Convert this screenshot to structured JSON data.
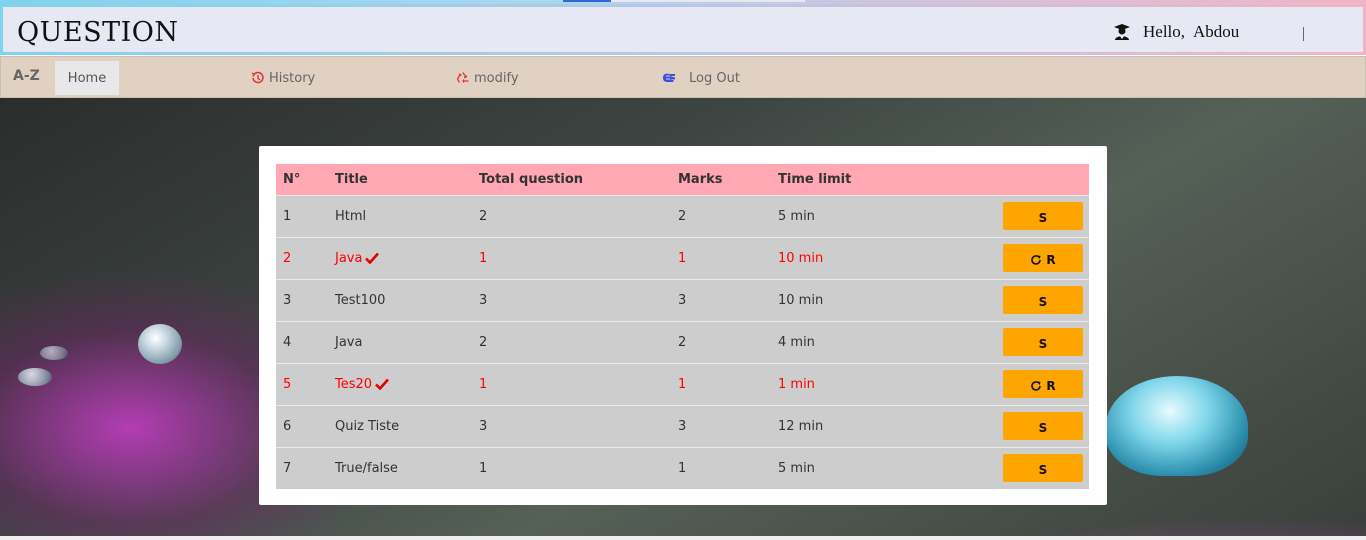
{
  "header": {
    "brand": "QUESTION",
    "greeting": "Hello,",
    "username": "Abdou"
  },
  "nav": {
    "logo": "A-Z",
    "home": "Home",
    "history": "History",
    "modify": "modify",
    "logout": "Log Out"
  },
  "table": {
    "headers": [
      "N°",
      "Title",
      "Total question",
      "Marks",
      "Time limit"
    ],
    "rows": [
      {
        "num": "1",
        "title": "Html",
        "total": "2",
        "marks": "2",
        "time": "5 min",
        "action": "S",
        "done": false
      },
      {
        "num": "2",
        "title": "Java",
        "total": "1",
        "marks": "1",
        "time": "10 min",
        "action": "R",
        "done": true
      },
      {
        "num": "3",
        "title": "Test100",
        "total": "3",
        "marks": "3",
        "time": "10 min",
        "action": "S",
        "done": false
      },
      {
        "num": "4",
        "title": "Java",
        "total": "2",
        "marks": "2",
        "time": "4 min",
        "action": "S",
        "done": false
      },
      {
        "num": "5",
        "title": "Tes20",
        "total": "1",
        "marks": "1",
        "time": "1 min",
        "action": "R",
        "done": true
      },
      {
        "num": "6",
        "title": "Quiz Tiste",
        "total": "3",
        "marks": "3",
        "time": "12 min",
        "action": "S",
        "done": false
      },
      {
        "num": "7",
        "title": "True/false",
        "total": "1",
        "marks": "1",
        "time": "5 min",
        "action": "S",
        "done": false
      }
    ]
  },
  "colors": {
    "header_row": "#ffa7b3",
    "row_bg": "#cdcdcd",
    "done_text": "#ff0000",
    "button": "#ffa500",
    "nav_bg": "#e0d1c3"
  }
}
